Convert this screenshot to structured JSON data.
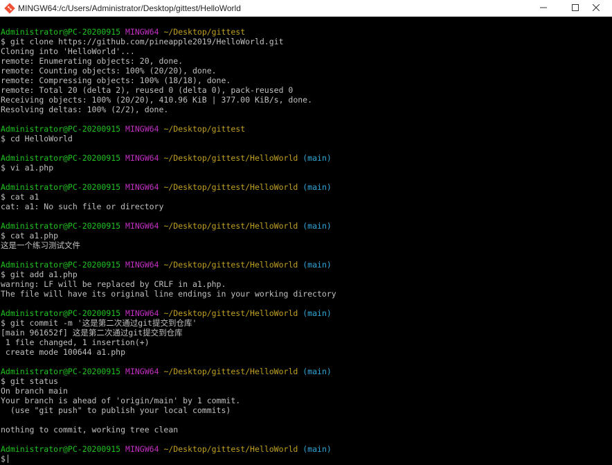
{
  "window": {
    "title": "MINGW64:/c/Users/Administrator/Desktop/gittest/HelloWorld",
    "icon": "git-bash-icon",
    "controls": {
      "minimize": "minimize-icon",
      "maximize": "maximize-icon",
      "close": "close-icon"
    }
  },
  "colors": {
    "background": "#000000",
    "text": "#c0c0c0",
    "user_host": "#1fc41f",
    "mingw": "#c32fc3",
    "path": "#c0a020",
    "branch": "#2fa8d8"
  },
  "prompt": {
    "user_host": "Administrator@PC-20200915",
    "shell": "MINGW64"
  },
  "terminal": {
    "p1": {
      "path": "~/Desktop/gittest",
      "branch": ""
    },
    "c1": "$ git clone https://github.com/pineapple2019/HelloWorld.git",
    "o1": [
      "Cloning into 'HelloWorld'...",
      "remote: Enumerating objects: 20, done.",
      "remote: Counting objects: 100% (20/20), done.",
      "remote: Compressing objects: 100% (18/18), done.",
      "remote: Total 20 (delta 2), reused 0 (delta 0), pack-reused 0",
      "Receiving objects: 100% (20/20), 410.96 KiB | 377.00 KiB/s, done.",
      "Resolving deltas: 100% (2/2), done."
    ],
    "p2": {
      "path": "~/Desktop/gittest",
      "branch": ""
    },
    "c2": "$ cd HelloWorld",
    "p3": {
      "path": "~/Desktop/gittest/HelloWorld",
      "branch": "(main)"
    },
    "c3": "$ vi a1.php",
    "p4": {
      "path": "~/Desktop/gittest/HelloWorld",
      "branch": "(main)"
    },
    "c4": "$ cat a1",
    "o4": [
      "cat: a1: No such file or directory"
    ],
    "p5": {
      "path": "~/Desktop/gittest/HelloWorld",
      "branch": "(main)"
    },
    "c5": "$ cat a1.php",
    "o5": [
      "这是一个练习测试文件"
    ],
    "p6": {
      "path": "~/Desktop/gittest/HelloWorld",
      "branch": "(main)"
    },
    "c6": "$ git add a1.php",
    "o6": [
      "warning: LF will be replaced by CRLF in a1.php.",
      "The file will have its original line endings in your working directory"
    ],
    "p7": {
      "path": "~/Desktop/gittest/HelloWorld",
      "branch": "(main)"
    },
    "c7": "$ git commit -m '这是第二次通过git提交到仓库'",
    "o7": [
      "[main 961652f] 这是第二次通过git提交到仓库",
      " 1 file changed, 1 insertion(+)",
      " create mode 100644 a1.php"
    ],
    "p8": {
      "path": "~/Desktop/gittest/HelloWorld",
      "branch": "(main)"
    },
    "c8": "$ git status",
    "o8": [
      "On branch main",
      "Your branch is ahead of 'origin/main' by 1 commit.",
      "  (use \"git push\" to publish your local commits)",
      "",
      "nothing to commit, working tree clean"
    ],
    "p9": {
      "path": "~/Desktop/gittest/HelloWorld",
      "branch": "(main)"
    },
    "c9": "$"
  }
}
